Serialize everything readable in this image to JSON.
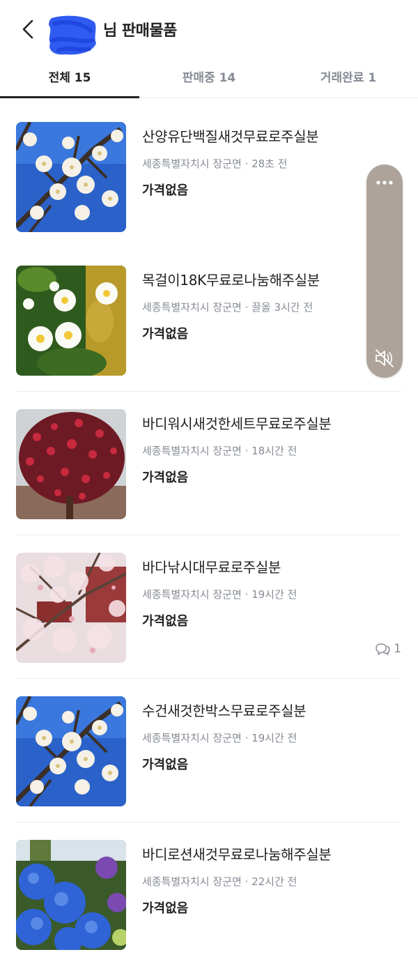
{
  "header": {
    "title": "님 판매물품",
    "back_icon": "chevron-left-icon"
  },
  "tabs": [
    {
      "label": "전체 15",
      "active": true
    },
    {
      "label": "판매중 14",
      "active": false
    },
    {
      "label": "거래완료 1",
      "active": false
    }
  ],
  "items": [
    {
      "title": "산양유단백질새것무료로주실분",
      "meta": "세종특별자치시 장군면 · 28초 전",
      "price": "가격없음",
      "image": "white-plum-blossoms"
    },
    {
      "title": "목걸이18K무료로나눔해주실분",
      "meta": "세종특별자치시 장군면 · 끌올 3시간 전",
      "price": "가격없음",
      "image": "white-flowers-yellow-center"
    },
    {
      "title": "바디워시새것한세트무료로주실분",
      "meta": "세종특별자치시 장군면 · 18시간 전",
      "price": "가격없음",
      "image": "red-camellia-tree"
    },
    {
      "title": "바다낚시대무료로주실분",
      "meta": "세종특별자치시 장군면 · 19시간 전",
      "price": "가격없음",
      "chat_count": "1",
      "image": "cherry-blossoms"
    },
    {
      "title": "수건새것한박스무료로주실분",
      "meta": "세종특별자치시 장군면 · 19시간 전",
      "price": "가격없음",
      "image": "white-plum-blossoms"
    },
    {
      "title": "바디로션새것무료로나눔해주실분",
      "meta": "세종특별자치시 장군면 · 22시간 전",
      "price": "가격없음",
      "image": "blue-hydrangeas"
    }
  ],
  "floating_panel": {
    "more_icon": "more-horizontal-icon",
    "mute_icon": "speaker-muted-icon"
  },
  "colors": {
    "text_primary": "#212124",
    "text_secondary": "#868b94",
    "divider": "#e9ecef",
    "floating_panel_bg": "#aea39a",
    "redaction": "#2f5bf0"
  }
}
